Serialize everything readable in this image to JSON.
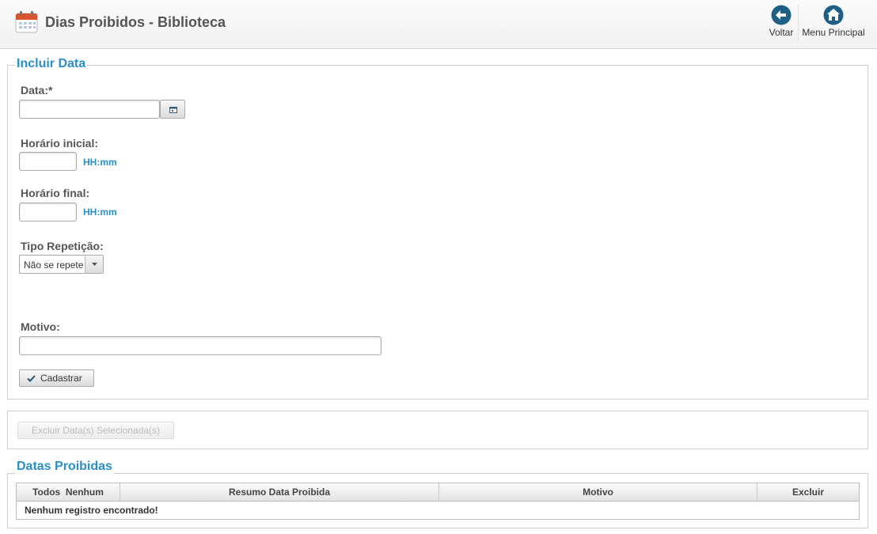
{
  "header": {
    "title": "Dias Proibidos - Biblioteca",
    "back_label": "Voltar",
    "menu_label": "Menu Principal"
  },
  "form": {
    "legend": "Incluir Data",
    "date_label": "Data:*",
    "date_value": "",
    "start_label": "Horário inicial:",
    "start_value": "",
    "start_hint": "HH:mm",
    "end_label": "Horário final:",
    "end_value": "",
    "end_hint": "HH:mm",
    "repeat_label": "Tipo Repetição:",
    "repeat_selected": "Não se repete",
    "reason_label": "Motivo:",
    "reason_value": "",
    "submit_label": "Cadastrar"
  },
  "actions": {
    "delete_selected_label": "Excluir Data(s) Selecionada(s)"
  },
  "list": {
    "legend": "Datas Proibidas",
    "columns": {
      "select_all": "Todos",
      "select_none": "Nenhum",
      "summary": "Resumo Data Proibida",
      "reason": "Motivo",
      "delete": "Excluir"
    },
    "empty_message": "Nenhum registro encontrado!"
  },
  "colors": {
    "accent": "#2a8fc9",
    "nav_icon": "#1f5f86"
  },
  "icons": [
    "calendar-icon",
    "back-arrow-icon",
    "home-icon",
    "calendar-small-icon",
    "dropdown-arrow-icon",
    "check-icon"
  ]
}
